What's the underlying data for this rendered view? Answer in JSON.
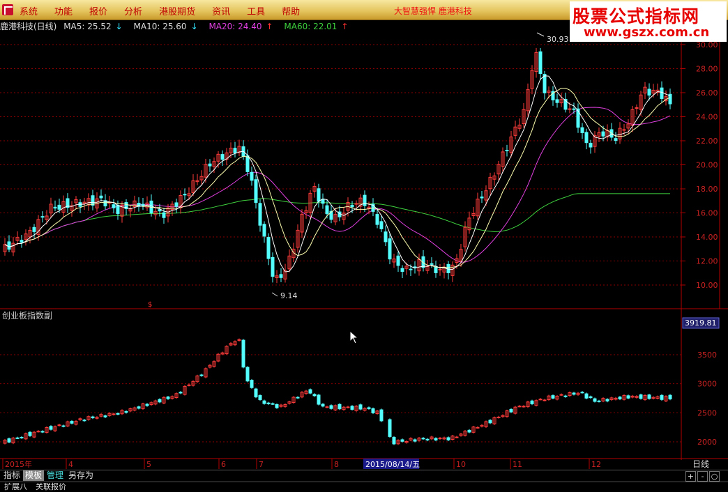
{
  "menu": {
    "items": [
      "系统",
      "功能",
      "报价",
      "分析",
      "港股期货",
      "资讯",
      "工具",
      "帮助"
    ],
    "ticker": "大智慧强悍  鹿港科技"
  },
  "banner": {
    "title": "股票公式指标网",
    "url": "www.gszx.com.cn"
  },
  "info": {
    "stock": "鹿港科技(日线)",
    "ma5_label": "MA5: 25.52",
    "ma5_arrow": "↓",
    "ma10_label": "MA10: 25.60",
    "ma10_arrow": "↓",
    "ma20_label": "MA20: 24.40",
    "ma20_arrow": "↑",
    "ma60_label": "MA60: 22.01",
    "ma60_arrow": "↑"
  },
  "main_axis": [
    "30.00",
    "28.00",
    "26.00",
    "24.00",
    "22.00",
    "20.00",
    "18.00",
    "16.00",
    "14.00",
    "12.00",
    "10.00"
  ],
  "high_label": "30.93",
  "low_label": "9.14",
  "sub_title": "创业板指数副",
  "sub_axis": [
    "3500",
    "3000",
    "2500",
    "2000"
  ],
  "sub_current": "3919.81",
  "x_labels": [
    "2015年",
    "4",
    "5",
    "6",
    "7",
    "8",
    "10",
    "11",
    "12"
  ],
  "x_selected": "2015/08/14/五",
  "period": "日线",
  "bottom_buttons": [
    "指标",
    "模板",
    "管理",
    "另存为"
  ],
  "bottom_row2": [
    "扩展八",
    "关联报价"
  ],
  "zoom_buttons": [
    "+",
    "-",
    "○"
  ],
  "colors": {
    "up": "#ff3c3c",
    "down": "#54ffff",
    "grid": "#8b0000",
    "ma20": "#e040e0",
    "ma60": "#3ed13e",
    "ma5": "#ffffff",
    "ma10": "#ffffb0"
  }
}
